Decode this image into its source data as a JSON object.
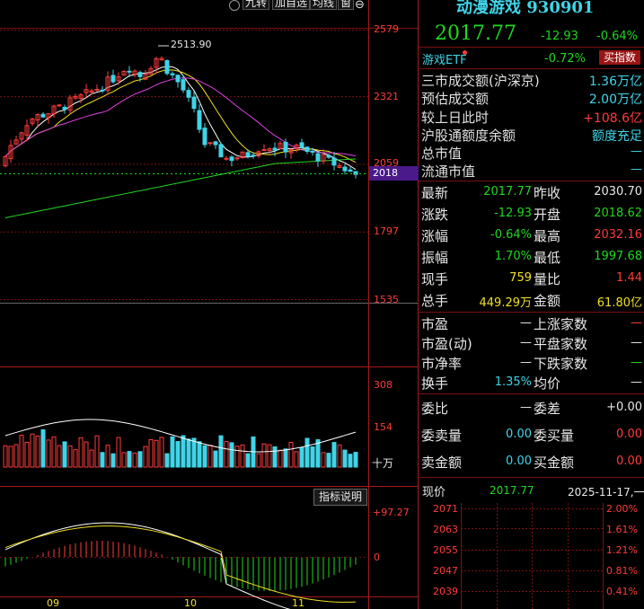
{
  "toolbar": {
    "buttons": [
      "九转",
      "加自选",
      "均线",
      "窗"
    ],
    "icons": [
      "settings-icon",
      "edit-icon",
      "eye-icon",
      "pin-icon",
      "hand-icon",
      "delete-icon",
      "zoom-in-icon",
      "zoom-out-icon"
    ]
  },
  "chart": {
    "price_ticks": [
      "2579",
      "2321",
      "2059",
      "1797",
      "1535"
    ],
    "current_tag": "2018",
    "high_label": "2513.90",
    "vol_ticks": [
      "308",
      "154"
    ],
    "vol_unit": "十万",
    "macd_button": "指标说明",
    "macd_ticks": [
      "+97.27",
      "0"
    ],
    "month_labels": [
      "09",
      "10",
      "11"
    ],
    "colors": {
      "up": "#ff3b3b",
      "down": "#3fd4e8",
      "ma5": "#ffffff",
      "ma10": "#f0e020",
      "ma20": "#e040e0",
      "ma60": "#1fd81f"
    }
  },
  "header": {
    "name": "动漫游戏 930901",
    "price": "2017.77",
    "change": "-12.93",
    "change_pct": "-0.64%"
  },
  "etf": {
    "label": "游戏ETF",
    "pct": "-0.72%",
    "button": "买指数"
  },
  "market": [
    {
      "label": "三市成交额(沪深京)",
      "value": "1.36万亿"
    },
    {
      "label": "预估成交额",
      "value": "2.00万亿"
    },
    {
      "label": "较上日此时",
      "value": "+108.6亿"
    },
    {
      "label": "沪股通额度余额",
      "value": "额度充足"
    },
    {
      "label": "总市值",
      "value": "—"
    },
    {
      "label": "流通市值",
      "value": "—"
    }
  ],
  "quote": [
    {
      "l1": "最新",
      "v1": "2017.77",
      "l2": "昨收",
      "v2": "2030.70"
    },
    {
      "l1": "涨跌",
      "v1": "-12.93",
      "l2": "开盘",
      "v2": "2018.62"
    },
    {
      "l1": "涨幅",
      "v1": "-0.64%",
      "l2": "最高",
      "v2": "2032.16"
    },
    {
      "l1": "振幅",
      "v1": "1.70%",
      "l2": "最低",
      "v2": "1997.68"
    },
    {
      "l1": "现手",
      "v1": "759",
      "l2": "量比",
      "v2": "1.44"
    },
    {
      "l1": "总手",
      "v1": "449.29万",
      "l2": "金额",
      "v2": "61.80亿"
    }
  ],
  "valuation": [
    {
      "l1": "市盈",
      "v1": "—",
      "l2": "上涨家数",
      "v2": "—"
    },
    {
      "l1": "市盈(动)",
      "v1": "—",
      "l2": "平盘家数",
      "v2": "—"
    },
    {
      "l1": "市净率",
      "v1": "—",
      "l2": "下跌家数",
      "v2": "—"
    },
    {
      "l1": "换手",
      "v1": "1.35%",
      "l2": "均价",
      "v2": "—"
    }
  ],
  "orders": [
    {
      "l1": "委比",
      "v1": "—",
      "l2": "委差",
      "v2": "+0.00"
    },
    {
      "l1": "委卖量",
      "v1": "0.00",
      "l2": "委买量",
      "v2": "0.00"
    },
    {
      "l1": "卖金额",
      "v1": "0.00",
      "l2": "买金额",
      "v2": "0.00"
    }
  ],
  "minute": {
    "label": "现价",
    "price": "2017.77",
    "date": "2025-11-17,一",
    "left_ticks": [
      "2071",
      "2063",
      "2055",
      "2047",
      "2039"
    ],
    "right_ticks": [
      "2.00%",
      "1.61%",
      "1.21%",
      "0.81%",
      "0.41%"
    ]
  }
}
